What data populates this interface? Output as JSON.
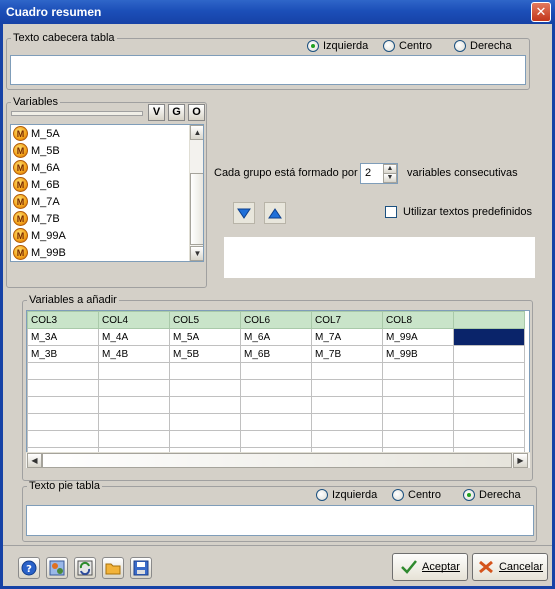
{
  "window": {
    "title": "Cuadro resumen"
  },
  "header": {
    "legend": "Texto cabecera tabla",
    "align_options": [
      "Izquierda",
      "Centro",
      "Derecha"
    ],
    "selected": "Izquierda",
    "text": ""
  },
  "variables": {
    "legend": "Variables",
    "buttons": [
      "V",
      "G",
      "O"
    ],
    "items": [
      "M_5A",
      "M_5B",
      "M_6A",
      "M_6B",
      "M_7A",
      "M_7B",
      "M_99A",
      "M_99B"
    ]
  },
  "group": {
    "label_prefix": "Cada grupo está formado por",
    "count": "2",
    "label_suffix": "variables consecutivas",
    "predefined_label": "Utilizar textos predefinidos",
    "predefined_checked": false
  },
  "add_vars": {
    "legend": "Variables a añadir",
    "columns": [
      "COL3",
      "COL4",
      "COL5",
      "COL6",
      "COL7",
      "COL8",
      ""
    ],
    "rows": [
      [
        "M_3A",
        "M_4A",
        "M_5A",
        "M_6A",
        "M_7A",
        "M_99A",
        ""
      ],
      [
        "M_3B",
        "M_4B",
        "M_5B",
        "M_6B",
        "M_7B",
        "M_99B",
        ""
      ]
    ]
  },
  "footer": {
    "legend": "Texto pie tabla",
    "align_options": [
      "Izquierda",
      "Centro",
      "Derecha"
    ],
    "selected": "Derecha",
    "text": ""
  },
  "toolbar": {
    "icons": [
      "help-icon",
      "settings-icon",
      "refresh-icon",
      "open-folder-icon",
      "save-icon"
    ]
  },
  "actions": {
    "accept": "Aceptar",
    "cancel": "Cancelar"
  },
  "colors": {
    "titlebar": "#1c4fb8",
    "header_row": "#c9e4c9",
    "selection": "#0a246a"
  }
}
